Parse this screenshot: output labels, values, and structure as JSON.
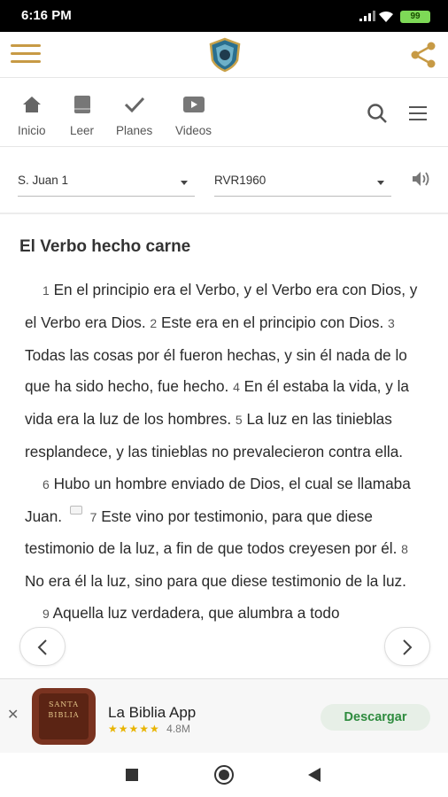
{
  "status": {
    "time": "6:16 PM",
    "battery": "99"
  },
  "nav": {
    "items": [
      {
        "label": "Inicio",
        "icon": "home-icon"
      },
      {
        "label": "Leer",
        "icon": "book-icon"
      },
      {
        "label": "Planes",
        "icon": "check-icon"
      },
      {
        "label": "Videos",
        "icon": "video-icon"
      }
    ]
  },
  "selectors": {
    "book": "S. Juan 1",
    "version": "RVR1960"
  },
  "content": {
    "heading": "El Verbo hecho carne",
    "verses": {
      "v1n": "1",
      "v1": "En el principio era el Verbo, y el Verbo era con Dios, y el Verbo era Dios.",
      "v2n": "2",
      "v2": "Este era en el principio con Dios.",
      "v3n": "3",
      "v3": "Todas las cosas por él fueron hechas, y sin él nada de lo que ha sido hecho, fue hecho.",
      "v4n": "4",
      "v4": "En él estaba la vida, y la vida era la luz de los hombres.",
      "v5n": "5",
      "v5": "La luz en las tinieblas resplandece, y las tinieblas no prevalecieron contra ella.",
      "v6n": "6",
      "v6": "Hubo un hombre enviado de Dios, el cual se llamaba Juan.",
      "v7n": "7",
      "v7": "Este vino por testimonio, para que diese testimonio de la luz, a fin de que todos creyesen por él.",
      "v8n": "8",
      "v8": "No era él la luz, sino para que diese testimonio de la luz.",
      "v9n": "9",
      "v9": "Aquella luz verdadera, que alumbra a todo"
    }
  },
  "ad": {
    "icon_text_1": "SANTA",
    "icon_text_2": "BIBLIA",
    "title": "La Biblia App",
    "stars": "★★★★★",
    "rating_count": "4.8M",
    "button": "Descargar",
    "close": "✕"
  },
  "colors": {
    "accent": "#c79a45",
    "install_green": "#2e8b3e"
  }
}
